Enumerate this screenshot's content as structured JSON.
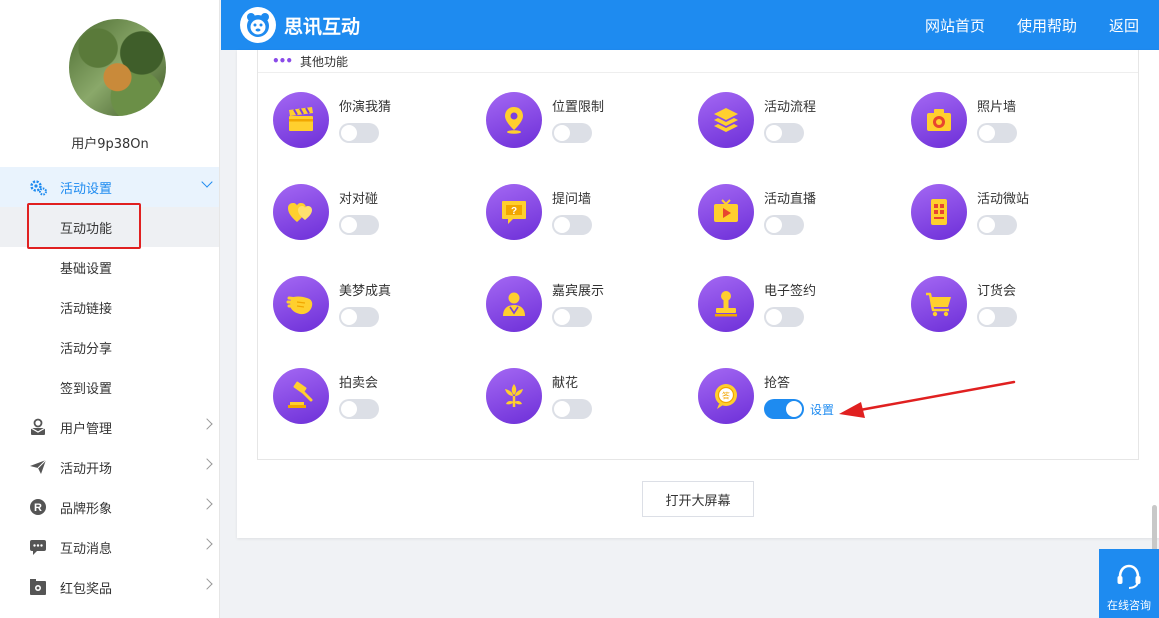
{
  "sidebar": {
    "username": "用户9p38On",
    "menu": [
      {
        "label": "活动设置",
        "icon": "gears-icon"
      },
      {
        "label": "用户管理",
        "icon": "user-mail-icon"
      },
      {
        "label": "活动开场",
        "icon": "paper-plane-icon"
      },
      {
        "label": "品牌形象",
        "icon": "registered-icon"
      },
      {
        "label": "互动消息",
        "icon": "chat-bubble-icon"
      },
      {
        "label": "红包奖品",
        "icon": "gift-box-icon"
      }
    ],
    "submenu": [
      "互动功能",
      "基础设置",
      "活动链接",
      "活动分享",
      "签到设置"
    ]
  },
  "header": {
    "brand": "思讯互动",
    "nav": [
      "网站首页",
      "使用帮助",
      "返回"
    ]
  },
  "section": {
    "title": "其他功能"
  },
  "features": [
    {
      "label": "你演我猜",
      "icon": "clapperboard-icon",
      "enabled": false
    },
    {
      "label": "位置限制",
      "icon": "location-pin-icon",
      "enabled": false
    },
    {
      "label": "活动流程",
      "icon": "layers-icon",
      "enabled": false
    },
    {
      "label": "照片墙",
      "icon": "camera-icon",
      "enabled": false
    },
    {
      "label": "对对碰",
      "icon": "double-heart-icon",
      "enabled": false
    },
    {
      "label": "提问墙",
      "icon": "question-board-icon",
      "enabled": false
    },
    {
      "label": "活动直播",
      "icon": "tv-play-icon",
      "enabled": false
    },
    {
      "label": "活动微站",
      "icon": "mobile-grid-icon",
      "enabled": false
    },
    {
      "label": "美梦成真",
      "icon": "wave-hand-icon",
      "enabled": false
    },
    {
      "label": "嘉宾展示",
      "icon": "guest-icon",
      "enabled": false
    },
    {
      "label": "电子签约",
      "icon": "stamp-icon",
      "enabled": false
    },
    {
      "label": "订货会",
      "icon": "shopping-cart-icon",
      "enabled": false
    },
    {
      "label": "拍卖会",
      "icon": "gavel-icon",
      "enabled": false
    },
    {
      "label": "献花",
      "icon": "flower-icon",
      "enabled": false
    },
    {
      "label": "抢答",
      "icon": "answer-bubble-icon",
      "enabled": true,
      "setting": "设置"
    }
  ],
  "buttons": {
    "big_screen": "打开大屏幕"
  },
  "consult": {
    "label": "在线咨询"
  },
  "colors": {
    "primary": "#1e8bf0",
    "icon_purple": "#8a4be8",
    "icon_yellow": "#ffcf2e",
    "highlight_red": "#e02020"
  }
}
